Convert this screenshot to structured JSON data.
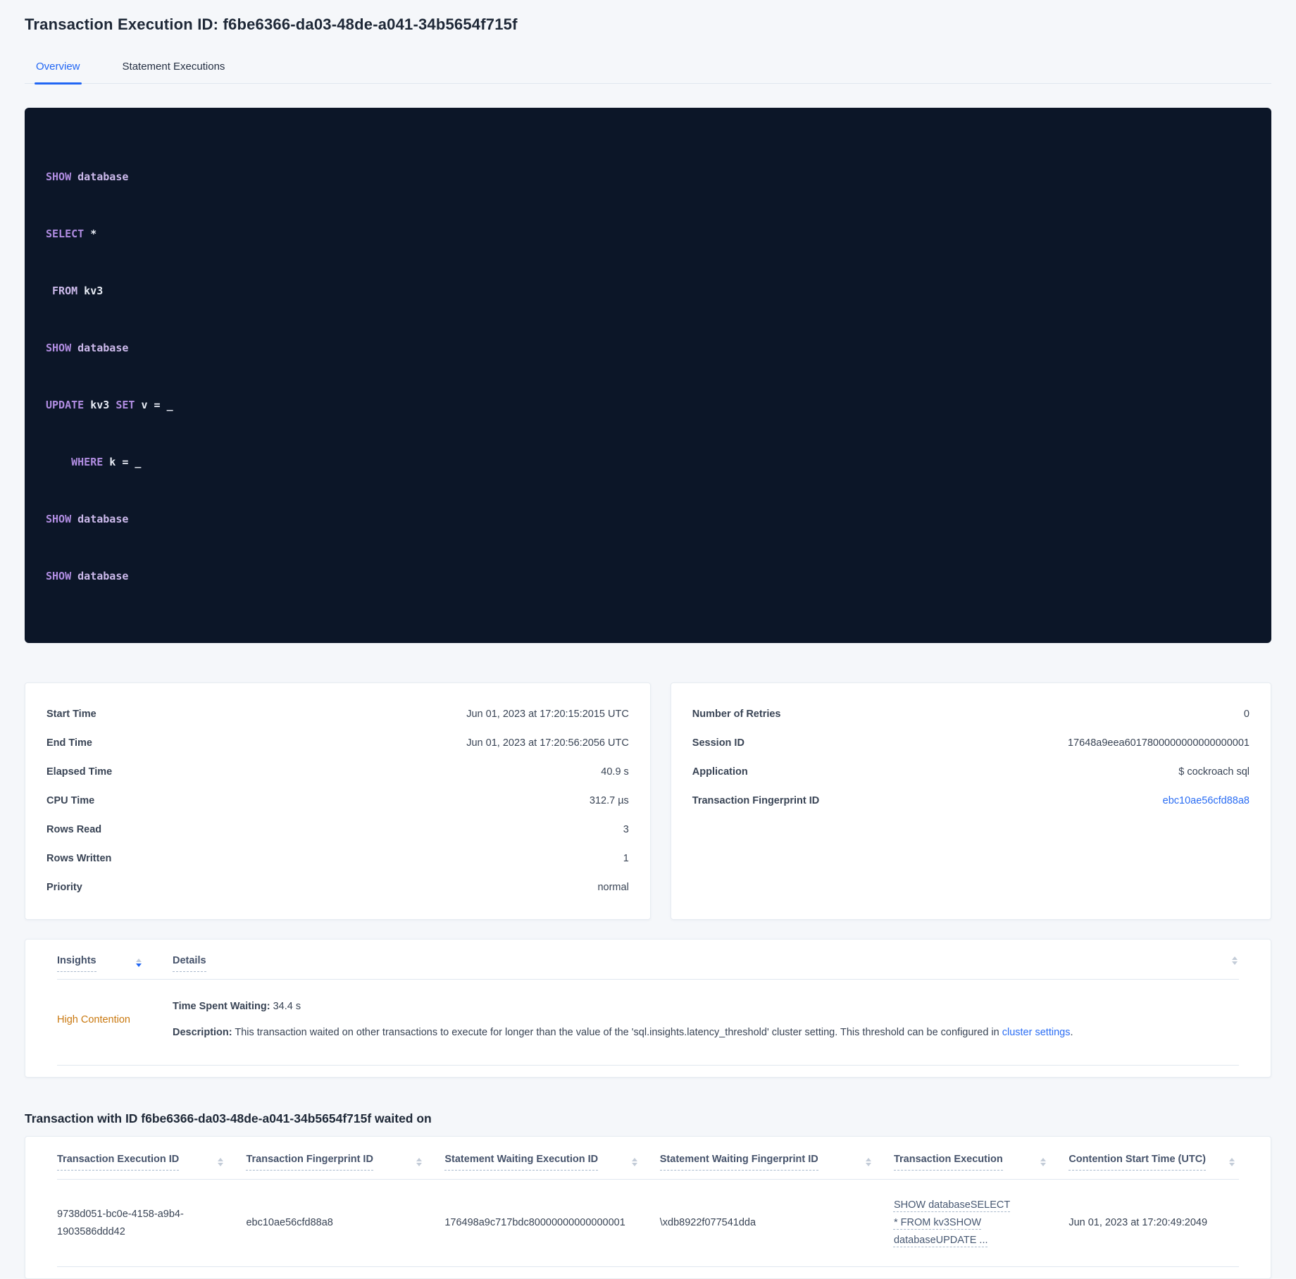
{
  "colors": {
    "accent_blue": "#2166f4",
    "link_blue": "#2a6df4",
    "insight_orange": "#c9780f",
    "code_background": "#0c1628",
    "code_keyword_purple": "#b18de2"
  },
  "header": {
    "title": "Transaction Execution ID: f6be6366-da03-48de-a041-34b5654f715f"
  },
  "tabs": {
    "overview": "Overview",
    "statement_executions": "Statement Executions"
  },
  "sql_lines": [
    [
      "SHOW",
      " database"
    ],
    [
      "SELECT",
      " *"
    ],
    [
      " FROM",
      " kv3"
    ],
    [
      "SHOW",
      " database"
    ],
    [
      "UPDATE",
      " kv3 ",
      "SET",
      " v = _"
    ],
    [
      "    WHERE",
      " k = _"
    ],
    [
      "SHOW",
      " database"
    ],
    [
      "SHOW",
      " database"
    ]
  ],
  "execution_card": {
    "rows": [
      {
        "label": "Start Time",
        "value": "Jun 01, 2023 at 17:20:15:2015 UTC"
      },
      {
        "label": "End Time",
        "value": "Jun 01, 2023 at 17:20:56:2056 UTC"
      },
      {
        "label": "Elapsed Time",
        "value": "40.9 s"
      },
      {
        "label": "CPU Time",
        "value": "312.7 µs"
      },
      {
        "label": "Rows Read",
        "value": "3"
      },
      {
        "label": "Rows Written",
        "value": "1"
      },
      {
        "label": "Priority",
        "value": "normal"
      }
    ]
  },
  "details_card": {
    "rows": [
      {
        "label": "Number of Retries",
        "value": "0"
      },
      {
        "label": "Session ID",
        "value": "17648a9eea6017800000000000000001"
      },
      {
        "label": "Application",
        "value": "$ cockroach sql"
      },
      {
        "label": "Transaction Fingerprint ID",
        "value": "ebc10ae56cfd88a8"
      }
    ]
  },
  "insights": {
    "col_insights": "Insights",
    "col_details": "Details",
    "row": {
      "insight": "High Contention",
      "waiting_label": "Time Spent Waiting:",
      "waiting_value": " 34.4 s",
      "description_label": "Description:",
      "description_text": " This transaction waited on other transactions to execute for longer than the value of the 'sql.insights.latency_threshold' cluster setting. This threshold can be configured in ",
      "description_link": "cluster settings",
      "description_period": "."
    }
  },
  "waited_on": {
    "heading": "Transaction with ID f6be6366-da03-48de-a041-34b5654f715f waited on",
    "columns": [
      "Transaction Execution ID",
      "Transaction Fingerprint ID",
      "Statement Waiting Execution ID",
      "Statement Waiting Fingerprint ID",
      "Transaction Execution",
      "Contention Start Time (UTC)"
    ],
    "row": {
      "transaction_execution_id": "9738d051-bc0e-4158-a9b4-1903586ddd42",
      "transaction_fingerprint_id": "ebc10ae56cfd88a8",
      "statement_waiting_execution_id": "176498a9c717bdc80000000000000001",
      "statement_waiting_fingerprint_id": "\\xdb8922f077541dda",
      "transaction_execution": "SHOW databaseSELECT * FROM kv3SHOW databaseUPDATE ...",
      "contention_start_time": "Jun 01, 2023 at 17:20:49:2049"
    }
  }
}
